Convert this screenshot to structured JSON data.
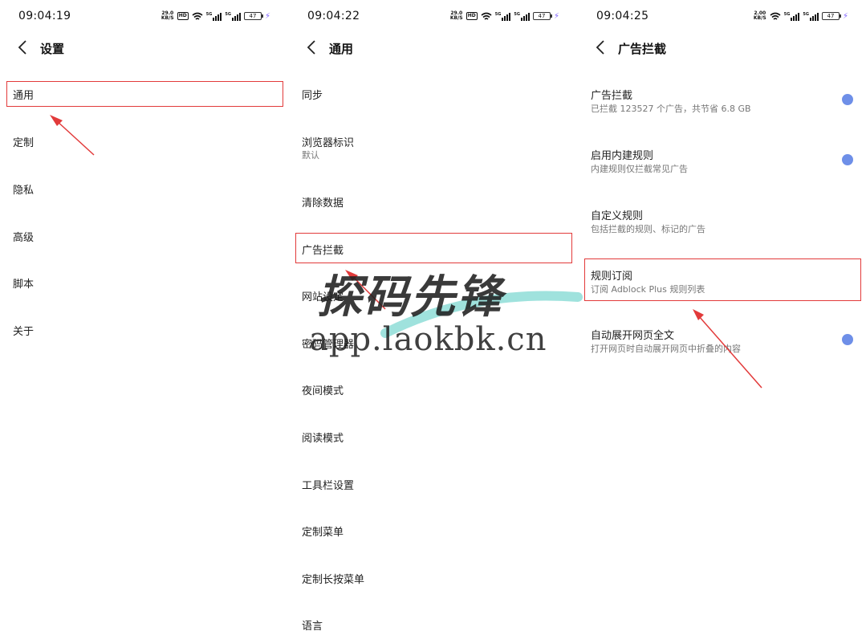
{
  "panels": [
    {
      "status": {
        "time": "09:04:19",
        "speed_top": "29.0",
        "speed_bottom": "KB/S",
        "battery": "47"
      },
      "title": "设置",
      "items": [
        {
          "label": "通用"
        },
        {
          "label": "定制"
        },
        {
          "label": "隐私"
        },
        {
          "label": "高级"
        },
        {
          "label": "脚本"
        },
        {
          "label": "关于"
        }
      ]
    },
    {
      "status": {
        "time": "09:04:22",
        "speed_top": "29.0",
        "speed_bottom": "KB/S",
        "battery": "47"
      },
      "title": "通用",
      "items": [
        {
          "label": "同步"
        },
        {
          "label": "浏览器标识",
          "sub": "默认"
        },
        {
          "label": "清除数据"
        },
        {
          "label": "广告拦截"
        },
        {
          "label": "网站设定"
        },
        {
          "label": "密码管理器"
        },
        {
          "label": "夜间模式"
        },
        {
          "label": "阅读模式"
        },
        {
          "label": "工具栏设置"
        },
        {
          "label": "定制菜单"
        },
        {
          "label": "定制长按菜单"
        },
        {
          "label": "语言"
        }
      ]
    },
    {
      "status": {
        "time": "09:04:25",
        "speed_top": "2.00",
        "speed_bottom": "KB/S",
        "battery": "47"
      },
      "title": "广告拦截",
      "items": [
        {
          "label": "广告拦截",
          "sub": "已拦截 123527 个广告，共节省 6.8 GB",
          "toggle": true
        },
        {
          "label": "启用内建规则",
          "sub": "内建规则仅拦截常见广告",
          "toggle": true
        },
        {
          "label": "自定义规则",
          "sub": "包括拦截的规则、标记的广告"
        },
        {
          "label": "规则订阅",
          "sub": "订阅 Adblock Plus 规则列表"
        },
        {
          "label": "自动展开网页全文",
          "sub": "打开网页时自动展开网页中折叠的内容",
          "toggle": true
        }
      ]
    }
  ],
  "watermark": {
    "text": "探码先锋",
    "url": "app.laokbk.cn"
  },
  "colors": {
    "highlight": "#e23a3a",
    "toggle": "#6e8fe8",
    "bolt": "#7b5cff"
  }
}
